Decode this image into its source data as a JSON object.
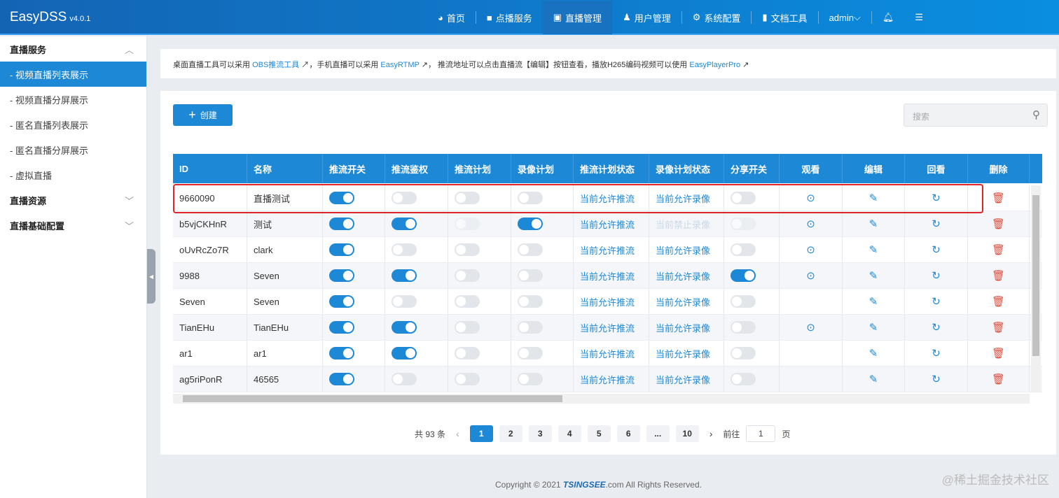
{
  "header": {
    "brand": "EasyDSS",
    "version": "v4.0.1",
    "nav": [
      {
        "icon": "dashboard-icon",
        "glyph": "◕",
        "label": "首页"
      },
      {
        "icon": "video-icon",
        "glyph": "■",
        "label": "点播服务"
      },
      {
        "icon": "tv-icon",
        "glyph": "▣",
        "label": "直播管理",
        "active": true
      },
      {
        "icon": "user-icon",
        "glyph": "♟",
        "label": "用户管理"
      },
      {
        "icon": "gear-icon",
        "glyph": "⚙",
        "label": "系统配置"
      },
      {
        "icon": "book-icon",
        "glyph": "▮",
        "label": "文档工具"
      }
    ],
    "user": "admin"
  },
  "sidebar": {
    "groups": [
      {
        "label": "直播服务",
        "expanded": true,
        "items": [
          "- 视频直播列表展示",
          "- 视频直播分屏展示",
          "- 匿名直播列表展示",
          "- 匿名直播分屏展示",
          "- 虚拟直播"
        ]
      },
      {
        "label": "直播资源"
      },
      {
        "label": "直播基础配置"
      }
    ]
  },
  "tip": {
    "t1": "桌面直播工具可以采用 ",
    "l1": "OBS推流工具",
    "t2": "，手机直播可以采用 ",
    "l2": "EasyRTMP",
    "t3": "， 推流地址可以点击直播流【编辑】按钮查看，播放H265编码视频可以使用 ",
    "l3": "EasyPlayerPro"
  },
  "toolbar": {
    "create": "创建",
    "search_placeholder": "搜索"
  },
  "table": {
    "columns": [
      "ID",
      "名称",
      "推流开关",
      "推流鉴权",
      "推流计划",
      "录像计划",
      "推流计划状态",
      "录像计划状态",
      "分享开关",
      "观看",
      "编辑",
      "回看",
      "删除"
    ],
    "rows": [
      {
        "id": "9660090",
        "name": "直播测试",
        "push": true,
        "auth": false,
        "plan": false,
        "rec": false,
        "push_status": "当前允许推流",
        "rec_status": "当前允许录像",
        "share": false,
        "watch": true
      },
      {
        "id": "b5vjCKHnR",
        "name": "测试",
        "push": true,
        "auth": true,
        "plan": false,
        "rec": true,
        "push_status": "当前允许推流",
        "rec_status": "当前禁止录像",
        "rec_status_disabled": true,
        "share": false,
        "watch": true,
        "disabled": true
      },
      {
        "id": "oUvRcZo7R",
        "name": "clark",
        "push": true,
        "auth": false,
        "plan": false,
        "rec": false,
        "push_status": "当前允许推流",
        "rec_status": "当前允许录像",
        "share": false,
        "watch": true
      },
      {
        "id": "9988",
        "name": "Seven",
        "push": true,
        "auth": true,
        "plan": false,
        "rec": false,
        "push_status": "当前允许推流",
        "rec_status": "当前允许录像",
        "share": true,
        "watch": true
      },
      {
        "id": "Seven",
        "name": "Seven",
        "push": true,
        "auth": false,
        "plan": false,
        "rec": false,
        "push_status": "当前允许推流",
        "rec_status": "当前允许录像",
        "share": false,
        "watch": false
      },
      {
        "id": "TianEHu",
        "name": "TianEHu",
        "push": true,
        "auth": true,
        "plan": false,
        "rec": false,
        "push_status": "当前允许推流",
        "rec_status": "当前允许录像",
        "share": false,
        "watch": true
      },
      {
        "id": "ar1",
        "name": "ar1",
        "push": true,
        "auth": true,
        "plan": false,
        "rec": false,
        "push_status": "当前允许推流",
        "rec_status": "当前允许录像",
        "share": false,
        "watch": false
      },
      {
        "id": "ag5riPonR",
        "name": "46565",
        "push": true,
        "auth": false,
        "plan": false,
        "rec": false,
        "push_status": "当前允许推流",
        "rec_status": "当前允许录像",
        "share": false,
        "watch": false
      }
    ]
  },
  "pagination": {
    "total": "共 93 条",
    "pages": [
      "1",
      "2",
      "3",
      "4",
      "5",
      "6",
      "...",
      "10"
    ],
    "current": "1",
    "goto_label": "前往",
    "goto_value": "1",
    "page_unit": "页"
  },
  "footer": {
    "pre": "Copyright © 2021 ",
    "brand": "TSINGSEE",
    "post": ".com All Rights Reserved."
  },
  "watermark": "@稀土掘金技术社区",
  "colors": {
    "primary": "#1d88d6",
    "danger": "#e24c3b",
    "highlight": "#e0252a"
  }
}
